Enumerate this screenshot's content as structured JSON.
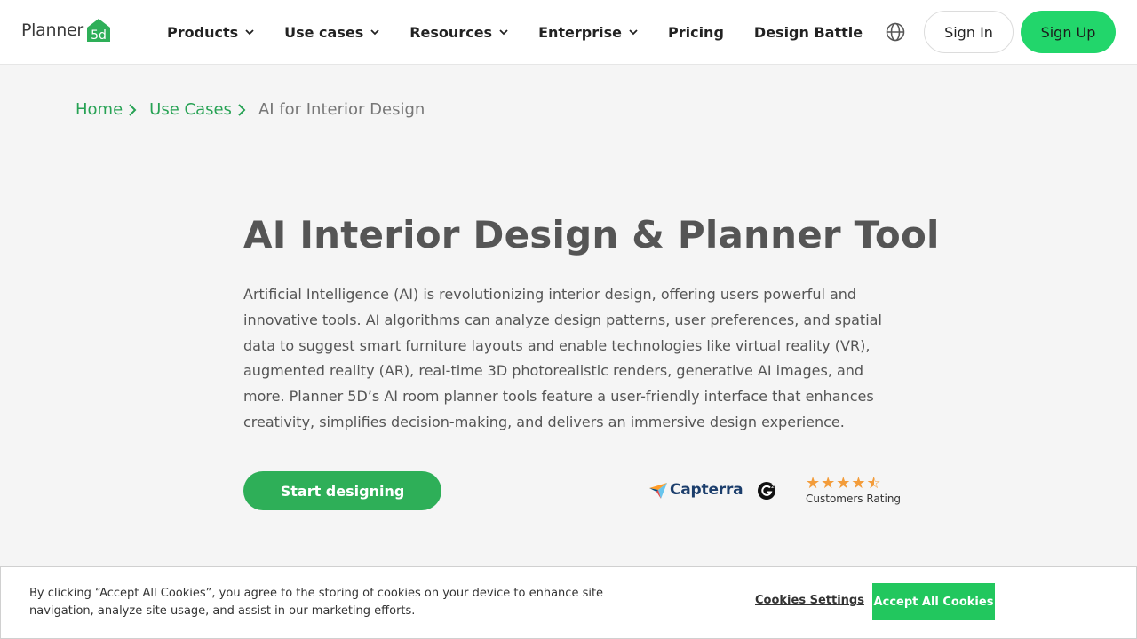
{
  "brand": {
    "name": "Planner",
    "mark": "5d",
    "accent": "#22d66b",
    "link_color": "#27a254"
  },
  "nav": {
    "items": [
      {
        "label": "Products",
        "dropdown": true
      },
      {
        "label": "Use cases",
        "dropdown": true
      },
      {
        "label": "Resources",
        "dropdown": true
      },
      {
        "label": "Enterprise",
        "dropdown": true
      },
      {
        "label": "Pricing",
        "dropdown": false
      },
      {
        "label": "Design Battle",
        "dropdown": false
      }
    ],
    "language_icon": "globe-icon",
    "sign_in": "Sign In",
    "sign_up": "Sign Up"
  },
  "breadcrumb": {
    "items": [
      {
        "label": "Home"
      },
      {
        "label": "Use Cases"
      }
    ],
    "current": "AI for Interior Design"
  },
  "hero": {
    "title": "AI Interior Design & Planner Tool",
    "body": "Artificial Intelligence (AI) is revolutionizing interior design, offering users powerful and innovative tools. AI algorithms can analyze design patterns, user preferences, and spatial data to suggest smart furniture layouts and enable technologies like virtual reality (VR), augmented reality (AR), real-time 3D photorealistic renders, generative AI images, and more. Planner 5D’s AI room planner tools feature a user-friendly interface that enhances creativity, simplifies decision-making, and delivers an immersive design experience.",
    "cta": "Start designing"
  },
  "ratings": {
    "capterra": "Capterra",
    "g2_icon": "g2-icon",
    "stars": 4.5,
    "stars_max": 5,
    "label": "Customers Rating"
  },
  "cookie": {
    "text": "By clicking “Accept All Cookies”, you agree to the storing of cookies on your device to enhance site navigation, analyze site usage, and assist in our marketing efforts.",
    "settings": "Cookies Settings",
    "accept": "Accept All Cookies"
  }
}
